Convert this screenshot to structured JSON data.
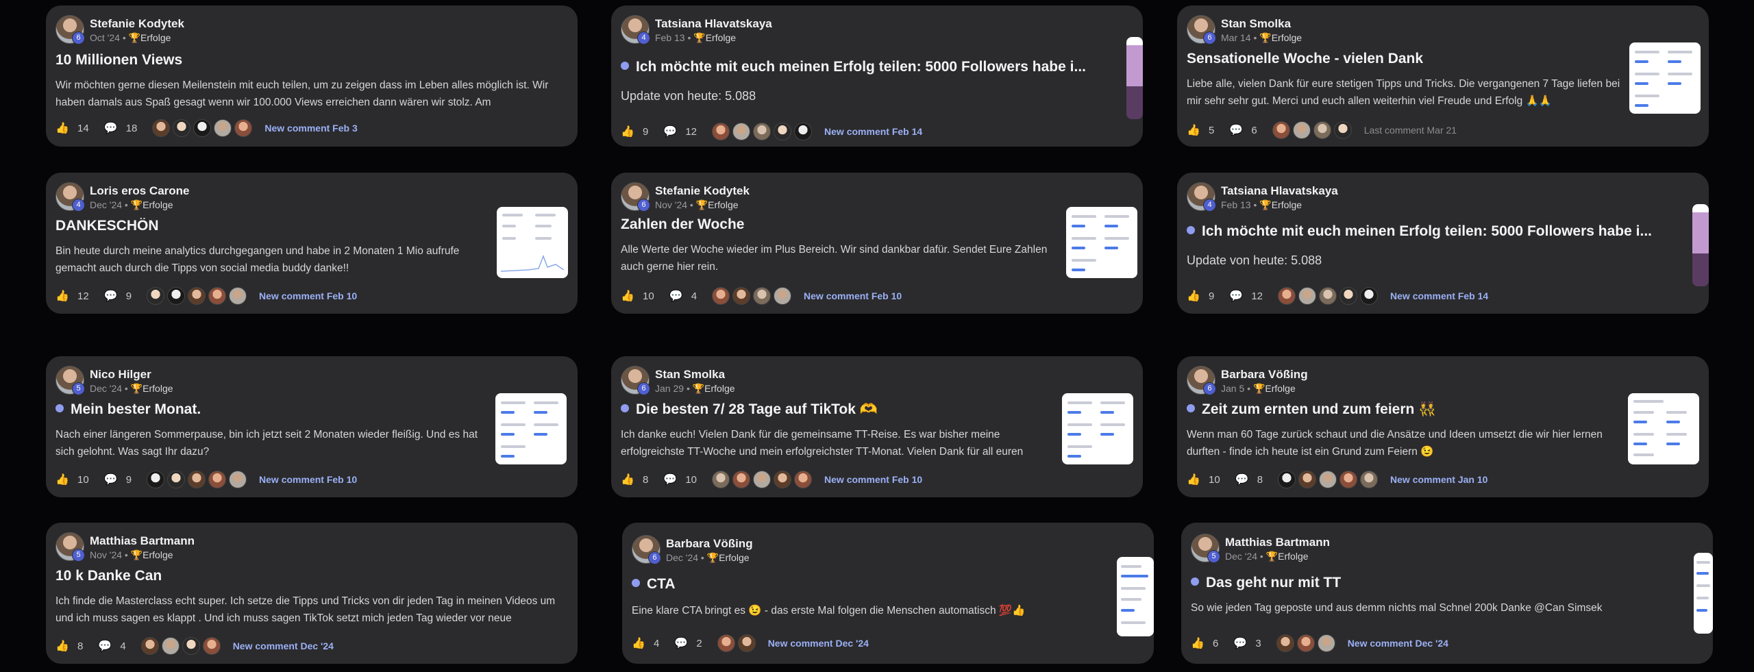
{
  "meta_separator": "•",
  "category_icon": "trophy-icon",
  "icons": {
    "like": "thumbs-up-icon",
    "comment": "comment-bubble-icon"
  },
  "posts": [
    {
      "author": "Stefanie Kodytek",
      "level": "6",
      "date": "Oct '24",
      "category": "Erfolge",
      "title": "10 Millionen Views",
      "dot": false,
      "body": "Wir möchten gerne diesen Meilenstein mit euch teilen, um zu zeigen dass im Leben alles möglich ist. Wir haben damals aus Spaß gesagt wenn wir 100.000 Views erreichen dann wären wir stolz. Am",
      "likes": "14",
      "comments": "18",
      "activity": "New comment Feb 3"
    },
    {
      "author": "Tatsiana Hlavatskaya",
      "level": "4",
      "date": "Feb 13",
      "category": "Erfolge",
      "title": "Ich möchte mit euch meinen Erfolg teilen: 5000 Followers habe i...",
      "dot": true,
      "body": "Update von heute: 5.088",
      "likes": "9",
      "comments": "12",
      "activity": "New comment Feb 14"
    },
    {
      "author": "Stan Smolka",
      "level": "6",
      "date": "Mar 14",
      "category": "Erfolge",
      "title": "Sensationelle Woche - vielen Dank",
      "dot": false,
      "body": "Liebe alle, vielen Dank für eure stetigen Tipps und Tricks. Die vergangenen 7 Tage liefen bei mir sehr sehr gut. Merci und euch allen weiterhin viel Freude und Erfolg 🙏🙏",
      "likes": "5",
      "comments": "6",
      "activity": "Last comment Mar 21"
    },
    {
      "author": "Loris eros Carone",
      "level": "4",
      "date": "Dec '24",
      "category": "Erfolge",
      "title": "DANKESCHÖN",
      "dot": false,
      "body": "Bin heute durch meine analytics durchgegangen und habe in 2 Monaten 1 Mio aufrufe gemacht auch durch die Tipps von social media buddy danke!!",
      "likes": "12",
      "comments": "9",
      "activity": "New comment Feb 10"
    },
    {
      "author": "Stefanie Kodytek",
      "level": "6",
      "date": "Nov '24",
      "category": "Erfolge",
      "title": "Zahlen der Woche",
      "dot": false,
      "body": "Alle Werte der Woche wieder im Plus Bereich. Wir sind dankbar dafür. Sendet Eure Zahlen auch gerne hier rein.",
      "likes": "10",
      "comments": "4",
      "activity": "New comment Feb 10"
    },
    {
      "author": "Tatsiana Hlavatskaya",
      "level": "4",
      "date": "Feb 13",
      "category": "Erfolge",
      "title": "Ich möchte mit euch meinen Erfolg teilen: 5000 Followers habe i...",
      "dot": true,
      "body": "Update von heute: 5.088",
      "likes": "9",
      "comments": "12",
      "activity": "New comment Feb 14"
    },
    {
      "author": "Nico Hilger",
      "level": "5",
      "date": "Dec '24",
      "category": "Erfolge",
      "title": "Mein bester Monat.",
      "dot": true,
      "body": "Nach einer längeren Sommerpause, bin ich jetzt seit 2 Monaten wieder fleißig. Und es hat sich gelohnt. Was sagt Ihr dazu?",
      "likes": "10",
      "comments": "9",
      "activity": "New comment Feb 10"
    },
    {
      "author": "Stan Smolka",
      "level": "6",
      "date": "Jan 29",
      "category": "Erfolge",
      "title": "Die besten 7/ 28 Tage auf TikTok 🫶",
      "dot": true,
      "body": "Ich danke euch! Vielen Dank für die gemeinsame TT-Reise. Es war bisher meine erfolgreichste TT-Woche und mein erfolgreichster TT-Monat. Vielen Dank für all euren",
      "likes": "8",
      "comments": "10",
      "activity": "New comment Feb 10"
    },
    {
      "author": "Barbara Vößing",
      "level": "6",
      "date": "Jan 5",
      "category": "Erfolge",
      "title": "Zeit zum ernten und zum feiern 👯",
      "dot": true,
      "body": "Wenn man 60 Tage zurück schaut und die Ansätze und Ideen umsetzt die wir hier lernen durften - finde ich heute ist ein Grund zum Feiern 😉",
      "likes": "10",
      "comments": "8",
      "activity": "New comment Jan 10"
    },
    {
      "author": "Matthias Bartmann",
      "level": "5",
      "date": "Nov '24",
      "category": "Erfolge",
      "title": "10 k Danke Can",
      "dot": false,
      "body": "Ich finde die Masterclass echt super. Ich setze die Tipps und Tricks von dir jeden Tag in meinen Videos um und ich muss sagen es klappt . Und ich muss sagen TikTok setzt mich jeden Tag wieder vor neue",
      "likes": "8",
      "comments": "4",
      "activity": "New comment Dec '24"
    },
    {
      "author": "Barbara Vößing",
      "level": "6",
      "date": "Dec '24",
      "category": "Erfolge",
      "title": "CTA",
      "dot": true,
      "body": "Eine klare CTA bringt es 😉 - das erste Mal folgen die Menschen automatisch 💯👍",
      "likes": "4",
      "comments": "2",
      "activity": "New comment Dec '24"
    },
    {
      "author": "Matthias Bartmann",
      "level": "5",
      "date": "Dec '24",
      "category": "Erfolge",
      "title": "Das geht nur mit TT",
      "dot": true,
      "body": "So wie jeden Tag geposte und aus demm nichts mal Schnel 200k Danke @Can Simsek",
      "likes": "6",
      "comments": "3",
      "activity": "New comment Dec '24"
    }
  ]
}
